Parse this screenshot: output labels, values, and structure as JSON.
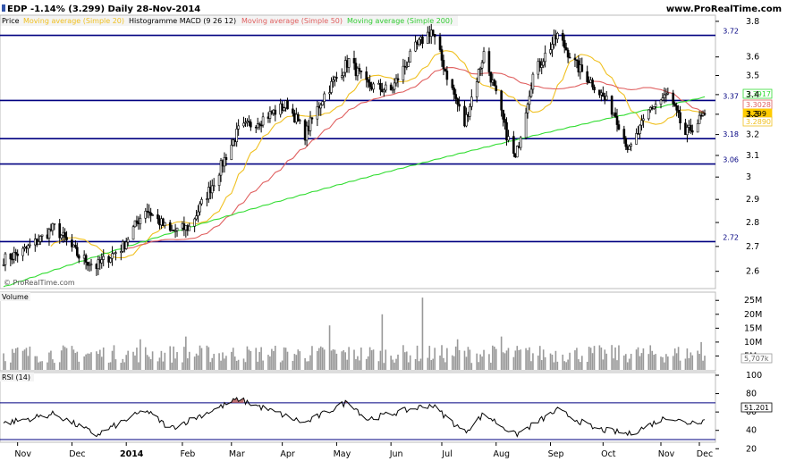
{
  "header": {
    "ticker_line": "EDP  -1.14% (3.299)  Daily  28-Nov-2014",
    "site": "www.ProRealTime.com"
  },
  "legend": {
    "price": "Price",
    "ma20": "Moving average (Simple 20)",
    "macd": "Histogramme MACD (9 26 12)",
    "ma50": "Moving average (Simple 50)",
    "ma200": "Moving average (Simple 200)",
    "copyright": "© ProRealTime.com"
  },
  "colors": {
    "ma20": "#f0c020",
    "ma50": "#e06060",
    "ma200": "#33dd33",
    "level": "#000080",
    "candle": "#000000",
    "volume": "#999999",
    "rsi_fill": "#b05050"
  },
  "chart_data": [
    {
      "type": "candlestick",
      "title": "EDP",
      "ylim": [
        2.55,
        3.82
      ],
      "y_scale": "log",
      "y_ticks": [
        "3.8",
        "3.6",
        "3.5",
        "3.4",
        "3.3",
        "3.2",
        "3.1",
        "3",
        "2.9",
        "2.8",
        "2.7",
        "2.6"
      ],
      "x_ticks": [
        "Nov",
        "Dec",
        "2014",
        "Feb",
        "Mar",
        "Apr",
        "May",
        "Jun",
        "Jul",
        "Aug",
        "Sep",
        "Oct",
        "Nov",
        "Dec"
      ],
      "close_anchors": [
        {
          "date": "2013-10-25",
          "close": 2.65
        },
        {
          "date": "2013-11-04",
          "close": 2.68
        },
        {
          "date": "2013-11-12",
          "close": 2.72
        },
        {
          "date": "2013-11-22",
          "close": 2.78
        },
        {
          "date": "2013-12-06",
          "close": 2.66
        },
        {
          "date": "2013-12-16",
          "close": 2.62
        },
        {
          "date": "2013-12-31",
          "close": 2.7
        },
        {
          "date": "2014-01-13",
          "close": 2.86
        },
        {
          "date": "2014-01-27",
          "close": 2.76
        },
        {
          "date": "2014-02-07",
          "close": 2.78
        },
        {
          "date": "2014-02-21",
          "close": 2.98
        },
        {
          "date": "2014-03-07",
          "close": 3.22
        },
        {
          "date": "2014-03-21",
          "close": 3.28
        },
        {
          "date": "2014-04-04",
          "close": 3.35
        },
        {
          "date": "2014-04-14",
          "close": 3.2
        },
        {
          "date": "2014-04-25",
          "close": 3.4
        },
        {
          "date": "2014-05-09",
          "close": 3.58
        },
        {
          "date": "2014-05-19",
          "close": 3.45
        },
        {
          "date": "2014-06-02",
          "close": 3.42
        },
        {
          "date": "2014-06-16",
          "close": 3.65
        },
        {
          "date": "2014-06-25",
          "close": 3.75
        },
        {
          "date": "2014-07-04",
          "close": 3.5
        },
        {
          "date": "2014-07-14",
          "close": 3.25
        },
        {
          "date": "2014-07-25",
          "close": 3.62
        },
        {
          "date": "2014-08-07",
          "close": 3.2
        },
        {
          "date": "2014-08-12",
          "close": 3.08
        },
        {
          "date": "2014-08-22",
          "close": 3.5
        },
        {
          "date": "2014-09-05",
          "close": 3.72
        },
        {
          "date": "2014-09-16",
          "close": 3.55
        },
        {
          "date": "2014-09-26",
          "close": 3.45
        },
        {
          "date": "2014-10-08",
          "close": 3.3
        },
        {
          "date": "2014-10-16",
          "close": 3.12
        },
        {
          "date": "2014-10-28",
          "close": 3.33
        },
        {
          "date": "2014-11-07",
          "close": 3.4
        },
        {
          "date": "2014-11-17",
          "close": 3.2
        },
        {
          "date": "2014-11-28",
          "close": 3.299
        }
      ],
      "levels": [
        {
          "label": "3.72",
          "value": 3.72
        },
        {
          "label": "3.37",
          "value": 3.37
        },
        {
          "label": "3.18",
          "value": 3.18
        },
        {
          "label": "3.06",
          "value": 3.06
        },
        {
          "label": "2.72",
          "value": 2.72
        }
      ],
      "last_values": [
        {
          "name": "Moving average (Simple 200)",
          "label": "3.3917",
          "color": "#33dd33"
        },
        {
          "name": "Moving average (Simple 50)",
          "label": "3.3028",
          "color": "#e06060"
        },
        {
          "name": "Price",
          "label": "3.299",
          "color": "#ffcc00"
        },
        {
          "name": "Moving average (Simple 20)",
          "label": "3.2890",
          "color": "#f0c020"
        }
      ]
    },
    {
      "type": "bar",
      "title": "Volume",
      "ylim": [
        0,
        27000000
      ],
      "y_ticks": [
        "25M",
        "20M",
        "15M",
        "10M",
        "5M"
      ],
      "last_label": "5,707k",
      "spikes": [
        {
          "date": "2014-01-10",
          "value": 11000000
        },
        {
          "date": "2014-02-05",
          "value": 12000000
        },
        {
          "date": "2014-04-28",
          "value": 16000000
        },
        {
          "date": "2014-05-28",
          "value": 20000000
        },
        {
          "date": "2014-06-20",
          "value": 26000000
        },
        {
          "date": "2014-07-10",
          "value": 11000000
        },
        {
          "date": "2014-08-04",
          "value": 12000000
        },
        {
          "date": "2014-11-26",
          "value": 10000000
        }
      ]
    },
    {
      "type": "line",
      "title": "RSI (14)",
      "ylim": [
        30,
        100
      ],
      "y_ticks": [
        "100",
        "80",
        "60",
        "40",
        "20"
      ],
      "bands": [
        70,
        30
      ],
      "last_label": "51.201",
      "anchors": [
        {
          "date": "2013-10-25",
          "value": 48
        },
        {
          "date": "2013-11-22",
          "value": 58
        },
        {
          "date": "2013-12-16",
          "value": 35
        },
        {
          "date": "2014-01-13",
          "value": 62
        },
        {
          "date": "2014-01-27",
          "value": 42
        },
        {
          "date": "2014-03-07",
          "value": 74
        },
        {
          "date": "2014-04-14",
          "value": 48
        },
        {
          "date": "2014-05-09",
          "value": 72
        },
        {
          "date": "2014-05-19",
          "value": 52
        },
        {
          "date": "2014-06-25",
          "value": 68
        },
        {
          "date": "2014-07-14",
          "value": 38
        },
        {
          "date": "2014-07-25",
          "value": 58
        },
        {
          "date": "2014-08-12",
          "value": 35
        },
        {
          "date": "2014-09-05",
          "value": 62
        },
        {
          "date": "2014-09-26",
          "value": 42
        },
        {
          "date": "2014-10-16",
          "value": 36
        },
        {
          "date": "2014-11-07",
          "value": 55
        },
        {
          "date": "2014-11-17",
          "value": 48
        },
        {
          "date": "2014-11-28",
          "value": 51
        }
      ]
    }
  ]
}
